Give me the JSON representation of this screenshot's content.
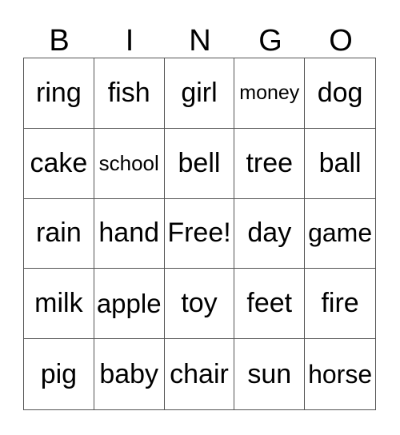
{
  "header": [
    "B",
    "I",
    "N",
    "G",
    "O"
  ],
  "cells": [
    [
      "ring",
      "fish",
      "girl",
      "money",
      "dog"
    ],
    [
      "cake",
      "school",
      "bell",
      "tree",
      "ball"
    ],
    [
      "rain",
      "hand",
      "Free!",
      "day",
      "game"
    ],
    [
      "milk",
      "apple",
      "toy",
      "feet",
      "fire"
    ],
    [
      "pig",
      "baby",
      "chair",
      "sun",
      "horse"
    ]
  ]
}
